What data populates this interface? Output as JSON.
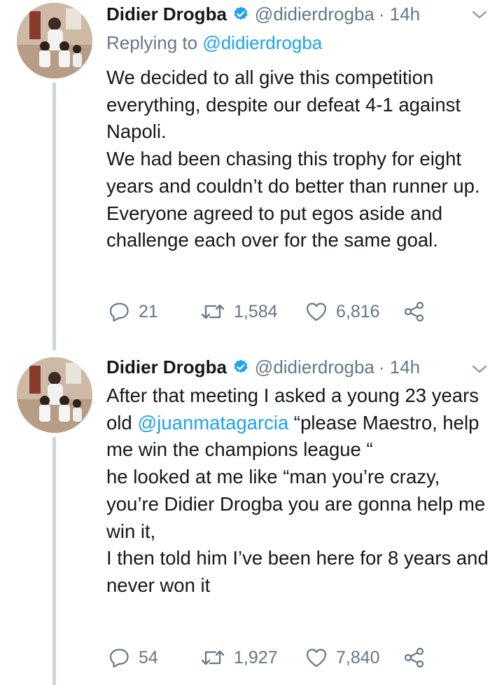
{
  "tweets": [
    {
      "name": "Didier Drogba",
      "handle": "@didierdrogba",
      "time": "· 14h",
      "reply_prefix": "Replying to",
      "reply_handle": "@didierdrogba",
      "lines": [
        "We decided to all give this competition everything, despite our defeat 4-1 against Napoli.",
        "We had been chasing this trophy for eight years and couldn’t do better than runner up.",
        "Everyone agreed to put egos aside and challenge each over for the same goal."
      ],
      "replies": "21",
      "retweets": "1,584",
      "likes": "6,816"
    },
    {
      "name": "Didier Drogba",
      "handle": "@didierdrogba",
      "time": "· 14h",
      "line1_a": "After that meeting I asked a young 23 years old ",
      "line1_mention": "@juanmatagarcia",
      "line1_b": " “please Maestro, help me win the champions league “",
      "line2": "he looked at me like “man you’re crazy, you’re Didier Drogba you are gonna help me win it,",
      "line3": "I then told him I’ve been here for 8 years and never won it",
      "replies": "54",
      "retweets": "1,927",
      "likes": "7,840"
    }
  ],
  "colors": {
    "text": "#14171a",
    "secondary": "#657786",
    "link": "#1da1f2",
    "thread_line": "#ccd6dd"
  }
}
